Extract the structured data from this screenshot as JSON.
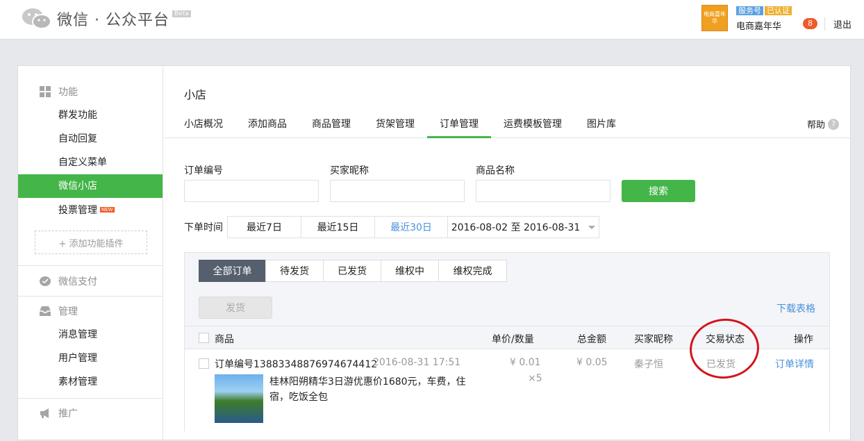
{
  "header": {
    "logo_text": "微信 · 公众平台",
    "beta": "Beta",
    "avatar_text": "电商嘉年华",
    "tag_service": "服务号",
    "tag_verified": "已认证",
    "account_name": "电商嘉年华",
    "badge_count": "8",
    "logout": "退出"
  },
  "sidebar": {
    "func_title": "功能",
    "func_items": [
      "群发功能",
      "自动回复",
      "自定义菜单",
      "微信小店",
      "投票管理"
    ],
    "new_tag": "NEW",
    "add_plugin": "+ 添加功能插件",
    "pay_title": "微信支付",
    "manage_title": "管理",
    "manage_items": [
      "消息管理",
      "用户管理",
      "素材管理"
    ],
    "promote_title": "推广"
  },
  "page": {
    "title": "小店",
    "tabs": [
      "小店概况",
      "添加商品",
      "商品管理",
      "货架管理",
      "订单管理",
      "运费模板管理",
      "图片库"
    ],
    "help": "帮助",
    "help_icon": "?"
  },
  "filters": {
    "order_no_label": "订单编号",
    "buyer_label": "买家昵称",
    "product_label": "商品名称",
    "search_button": "搜索",
    "date_label": "下单时间",
    "ranges": [
      "最近7日",
      "最近15日",
      "最近30日"
    ],
    "date_range": "2016-08-02 至 2016-08-31"
  },
  "orders": {
    "status_tabs": [
      "全部订单",
      "待发货",
      "已发货",
      "维权中",
      "维权完成"
    ],
    "ship_button": "发货",
    "download": "下载表格",
    "columns": [
      "商品",
      "单价/数量",
      "总金额",
      "买家昵称",
      "交易状态",
      "操作"
    ],
    "row": {
      "order_no": "订单编号13883348876974674412",
      "time": "2016-08-31 17:51",
      "price": "¥ 0.01",
      "qty": "×5",
      "total": "¥ 0.05",
      "buyer": "秦子恒",
      "status": "已发货",
      "action": "订单详情",
      "product_line1": "桂林阳朔精华3日游优惠价1680元，车费，住",
      "product_line2": "宿，吃饭全包"
    }
  },
  "colors": {
    "accent": "#44b549",
    "link": "#4a90d9",
    "annotation": "#d2151d"
  }
}
